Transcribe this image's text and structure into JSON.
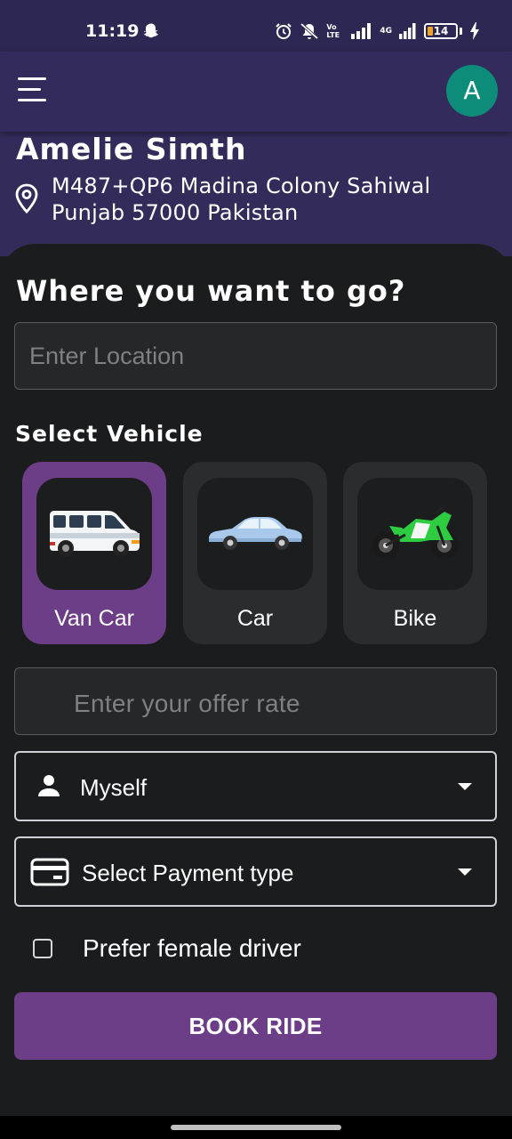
{
  "status_bar": {
    "time": "11:19",
    "network_label": "4G",
    "volte_label": "Vo LTE",
    "battery_level": "14",
    "icons": [
      "snapchat-icon",
      "alarm-icon",
      "mute-icon",
      "volte-icon",
      "signal-icon",
      "battery-icon",
      "charging-icon"
    ]
  },
  "app_bar": {
    "menu_icon": "hamburger-menu-icon",
    "avatar_initial": "A",
    "avatar_color": "#0d8d79"
  },
  "user": {
    "name": "Amelie Simth",
    "address_line1": "M487+QP6 Madina Colony Sahiwal",
    "address_line2": "Punjab 57000 Pakistan",
    "pin_icon": "location-pin-icon"
  },
  "form": {
    "title": "Where you want to go?",
    "location_placeholder": "Enter Location",
    "vehicle_section_label": "Select Vehicle",
    "vehicles": [
      {
        "label": "Van Car",
        "icon": "van-icon",
        "selected": true
      },
      {
        "label": "Car",
        "icon": "car-icon",
        "selected": false
      },
      {
        "label": "Bike",
        "icon": "motorbike-icon",
        "selected": false
      }
    ],
    "offer_placeholder": "Enter your offer rate",
    "passenger_value": "Myself",
    "payment_placeholder": "Select Payment type",
    "female_driver_label": "Prefer female driver",
    "female_driver_checked": false,
    "book_button": "BOOK RIDE"
  },
  "colors": {
    "accent": "#6c3e87",
    "header_bg": "#322b5c",
    "background": "#1b1c1d"
  }
}
